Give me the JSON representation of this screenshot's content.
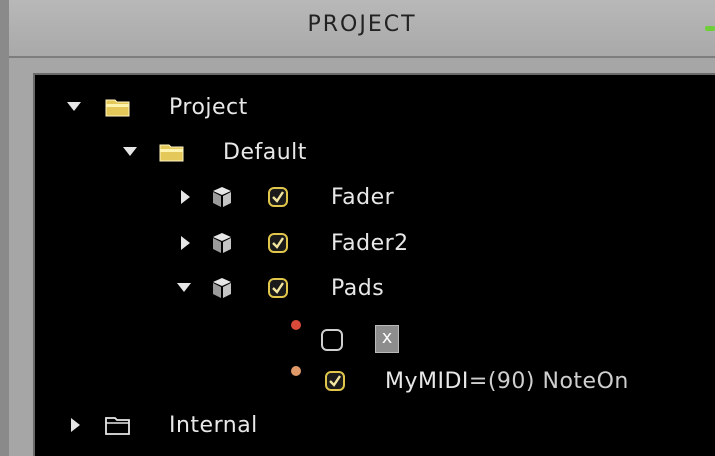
{
  "window": {
    "title": "PROJECT"
  },
  "tree": {
    "project": {
      "label": "Project",
      "icon": "folder-open-icon",
      "expanded": true
    },
    "default": {
      "label": "Default",
      "icon": "folder-open-icon",
      "expanded": true
    },
    "fader": {
      "label": "Fader",
      "icon": "cube-icon",
      "checked": true,
      "expanded": false
    },
    "fader2": {
      "label": "Fader2",
      "icon": "cube-icon",
      "checked": true,
      "expanded": false
    },
    "pads": {
      "label": "Pads",
      "icon": "cube-icon",
      "checked": true,
      "expanded": true
    },
    "pad_item_1": {
      "status_color": "#d94a3a",
      "checked": false,
      "value": "x"
    },
    "pad_item_2": {
      "status_color": "#e09a6a",
      "checked": true,
      "name": "MyMIDI",
      "value": "=(90) NoteOn"
    },
    "internal": {
      "label": "Internal",
      "icon": "folder-closed-icon",
      "expanded": false
    }
  },
  "colors": {
    "folder": "#e4c95a",
    "check": "#e0c64a",
    "accent": "#6fcf3a"
  }
}
